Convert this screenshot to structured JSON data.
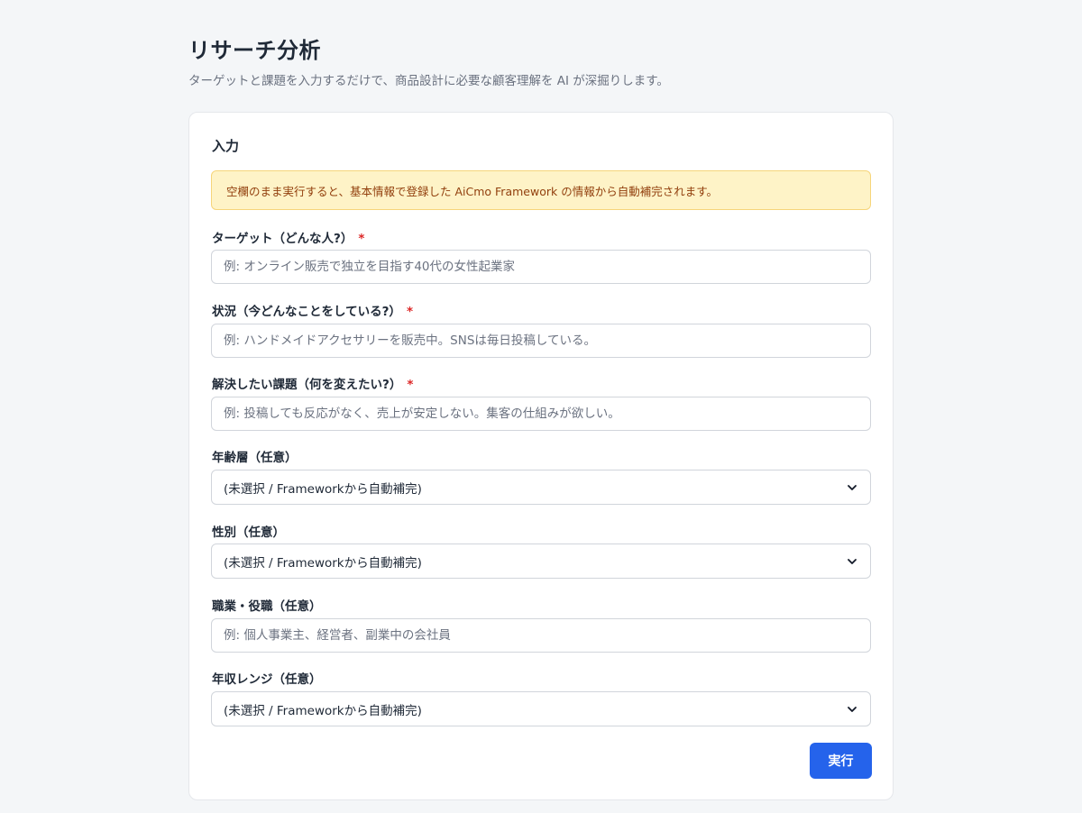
{
  "header": {
    "title": "リサーチ分析",
    "subtitle": "ターゲットと課題を入力するだけで、商品設計に必要な顧客理解を AI が深掘りします。"
  },
  "form": {
    "section_title": "入力",
    "notice": "空欄のまま実行すると、基本情報で登録した AiCmo Framework の情報から自動補完されます。",
    "required_mark": "*",
    "fields": {
      "target": {
        "label": "ターゲット（どんな人?）",
        "required": true,
        "value": "",
        "placeholder": "例: オンライン販売で独立を目指す40代の女性起業家"
      },
      "situation": {
        "label": "状況（今どんなことをしている?）",
        "required": true,
        "value": "",
        "placeholder": "例: ハンドメイドアクセサリーを販売中。SNSは毎日投稿している。"
      },
      "problem": {
        "label": "解決したい課題（何を変えたい?）",
        "required": true,
        "value": "",
        "placeholder": "例: 投稿しても反応がなく、売上が安定しない。集客の仕組みが欲しい。"
      },
      "age": {
        "label": "年齢層（任意）",
        "selected": "(未選択 / Frameworkから自動補完)"
      },
      "gender": {
        "label": "性別（任意）",
        "selected": "(未選択 / Frameworkから自動補完)"
      },
      "occupation": {
        "label": "職業・役職（任意）",
        "value": "",
        "placeholder": "例: 個人事業主、経営者、副業中の会社員"
      },
      "income": {
        "label": "年収レンジ（任意）",
        "selected": "(未選択 / Frameworkから自動補完)"
      }
    },
    "submit_label": "実行"
  },
  "icons": {
    "select_arrow": "chevron-down-icon"
  },
  "colors": {
    "primary": "#2563eb",
    "required": "#dc2626",
    "notice_bg": "#fef3c7",
    "notice_text": "#92400e"
  }
}
